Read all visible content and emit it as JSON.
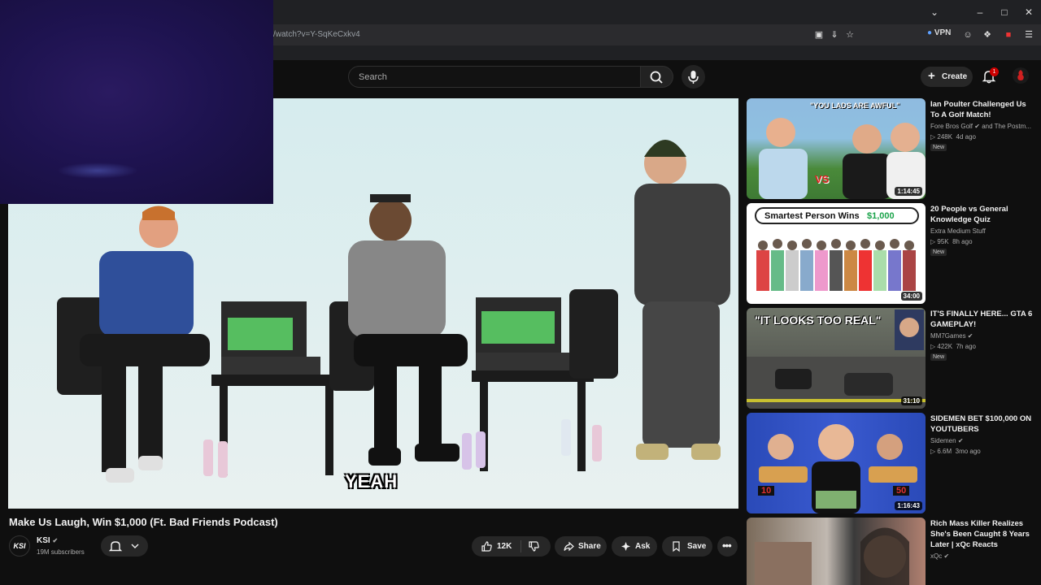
{
  "browser": {
    "url": "/watch?v=Y-SqKeCxkv4",
    "vpn_label": "VPN"
  },
  "header": {
    "search_placeholder": "Search",
    "create_label": "Create",
    "notification_count": "1"
  },
  "video": {
    "caption": "YEAH",
    "title": "Make Us Laugh, Win $1,000 (Ft. Bad Friends Podcast)",
    "channel": {
      "name": "KSI",
      "subscribers": "19M subscribers",
      "avatar_text": "KSI"
    },
    "actions": {
      "likes": "12K",
      "share_label": "Share",
      "ask_label": "Ask",
      "save_label": "Save"
    }
  },
  "related": [
    {
      "title": "Ian Poulter Challenged Us To A Golf Match!",
      "channel": "Fore Bros Golf",
      "channel_extra": "and The Postm...",
      "views": "248K",
      "age": "4d ago",
      "badge": "New",
      "duration": "1:14:45",
      "thumb_text": "\"YOU LADS ARE AWFUL\"",
      "thumb_vs": "VS"
    },
    {
      "title": "20 People vs General Knowledge Quiz",
      "channel": "Extra Medium Stuff",
      "views": "95K",
      "age": "8h ago",
      "badge": "New",
      "duration": "34:00",
      "thumb_text": "Smartest Person Wins",
      "thumb_amount": "$1,000"
    },
    {
      "title": "IT'S FINALLY HERE... GTA 6 GAMEPLAY!",
      "channel": "MM7Games",
      "views": "422K",
      "age": "7h ago",
      "badge": "New",
      "duration": "31:10",
      "thumb_text": "\"IT LOOKS TOO REAL\""
    },
    {
      "title": "SIDEMEN BET $100,000 ON YOUTUBERS",
      "channel": "Sidemen",
      "views": "6.6M",
      "age": "3mo ago",
      "duration": "1:16:43",
      "thumb_left": "10",
      "thumb_right": "50"
    },
    {
      "title": "Rich Mass Killer Realizes She's Been Caught 8 Years Later | xQc Reacts",
      "channel": "xQc"
    }
  ]
}
